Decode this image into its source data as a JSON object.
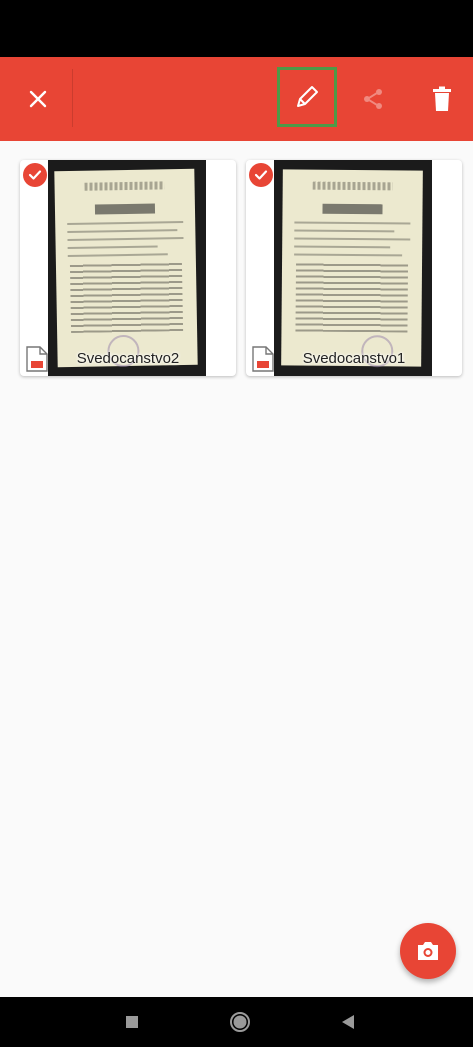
{
  "toolbar": {
    "close_icon": "close-icon",
    "edit_icon": "pencil-icon",
    "share_icon": "share-icon",
    "delete_icon": "trash-icon",
    "accent_color": "#e84535"
  },
  "documents": [
    {
      "name": "Svedocanstvo2",
      "selected": true
    },
    {
      "name": "Svedocanstvo1",
      "selected": true
    }
  ],
  "fab": {
    "icon": "camera-icon"
  },
  "nav": {
    "recents_icon": "square-icon",
    "home_icon": "circle-icon",
    "back_icon": "triangle-back-icon"
  }
}
